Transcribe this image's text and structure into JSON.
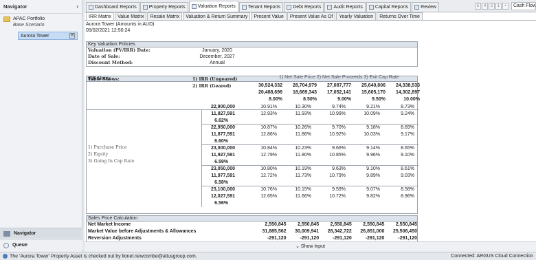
{
  "navigator": {
    "title": "Navigator",
    "collapse_glyph": "‹",
    "portfolio": "APAC Portfolio",
    "scenario": "Base Scenario",
    "property": "Aurora Tower",
    "close_glyph": "✕",
    "tab_navigator": "Navigator",
    "tab_queue": "Queue"
  },
  "tabs": [
    {
      "label": "Dashboard Reports"
    },
    {
      "label": "Property Reports"
    },
    {
      "label": "Valuation Reports"
    },
    {
      "label": "Tenant Reports"
    },
    {
      "label": "Debt Reports"
    },
    {
      "label": "Audit Reports"
    },
    {
      "label": "Capital Reports"
    },
    {
      "label": "Review"
    }
  ],
  "pager": [
    "5",
    "4",
    "2",
    "1",
    "•"
  ],
  "cashflow_select": "Cash Flow",
  "subtabs": [
    {
      "label": "IRR Matrix"
    },
    {
      "label": "Value Matrix"
    },
    {
      "label": "Resale Matrix"
    },
    {
      "label": "Valuation & Return Summary"
    },
    {
      "label": "Present Value"
    },
    {
      "label": "Present Value As Of"
    },
    {
      "label": "Yearly Valuation"
    },
    {
      "label": "Returns Over Time"
    }
  ],
  "report": {
    "title": "Aurora Tower (Amounts in AUD)",
    "datetime": "05/02/2021 12:50:24",
    "policies_title": "Key Valuation Policies",
    "policies": [
      {
        "k": "Valuation (PV/IRR) Date:",
        "v": "January, 2020"
      },
      {
        "k": "Date of Sale:",
        "v": "December, 2027"
      },
      {
        "k": "Discount Method:",
        "v": "Annual"
      }
    ],
    "irr_title": "IRR Matrix",
    "table_shows": "Table Shows:",
    "irr_options": [
      "1) IRR (Ungeared)",
      "2) IRR (Geared)"
    ],
    "col_heading": "1)  Net Sale Price 2)  Net Sale Proceeds 3)  Exit Cap Rate",
    "cols": [
      {
        "a": "30,524,332",
        "b": "20,488,696",
        "c": "8.00%"
      },
      {
        "a": "28,704,979",
        "b": "18,669,343",
        "c": "8.50%"
      },
      {
        "a": "27,087,777",
        "b": "17,052,141",
        "c": "9.00%"
      },
      {
        "a": "25,640,806",
        "b": "15,605,170",
        "c": "9.50%"
      },
      {
        "a": "24,338,533",
        "b": "14,302,897",
        "c": "10.00%"
      }
    ],
    "row_labels": [
      "1) Purchase Price",
      "2) Equity",
      "3) Going In Cap Rate"
    ],
    "rows": [
      {
        "p": "22,900,000",
        "e": "11,827,591",
        "g": "6.62%",
        "u": [
          "10.91%",
          "10.30%",
          "9.74%",
          "9.21%",
          "8.73%"
        ],
        "gr": [
          "12.93%",
          "11.93%",
          "10.99%",
          "10.09%",
          "9.24%"
        ]
      },
      {
        "p": "22,950,000",
        "e": "11,877,591",
        "g": "6.60%",
        "u": [
          "10.87%",
          "10.26%",
          "9.70%",
          "9.18%",
          "8.69%"
        ],
        "gr": [
          "12.86%",
          "11.86%",
          "10.92%",
          "10.03%",
          "9.17%"
        ]
      },
      {
        "p": "23,000,000",
        "e": "11,927,591",
        "g": "6.59%",
        "u": [
          "10.84%",
          "10.23%",
          "9.66%",
          "9.14%",
          "8.65%"
        ],
        "gr": [
          "12.79%",
          "11.80%",
          "10.85%",
          "9.96%",
          "9.10%"
        ]
      },
      {
        "p": "23,050,000",
        "e": "11,977,591",
        "g": "6.58%",
        "u": [
          "10.80%",
          "10.19%",
          "9.63%",
          "9.10%",
          "8.61%"
        ],
        "gr": [
          "12.72%",
          "11.73%",
          "10.79%",
          "9.89%",
          "9.03%"
        ]
      },
      {
        "p": "23,100,000",
        "e": "12,027,591",
        "g": "6.56%",
        "u": [
          "10.76%",
          "10.15%",
          "9.59%",
          "9.07%",
          "8.58%"
        ],
        "gr": [
          "12.65%",
          "11.66%",
          "10.72%",
          "9.82%",
          "8.96%"
        ]
      }
    ],
    "sales_title": "Sales Price Calculation",
    "sales_rows": [
      {
        "label": "Net Market Income",
        "v": [
          "2,550,845",
          "2,550,845",
          "2,550,845",
          "2,550,845",
          "2,550,845"
        ]
      },
      {
        "label": "Market Value before Adjustments & Allowances",
        "v": [
          "31,885,562",
          "30,009,941",
          "28,342,722",
          "26,851,000",
          "25,508,450"
        ]
      },
      {
        "label": "Reversion Adjustments",
        "v": [
          "-291,120",
          "-291,120",
          "-291,120",
          "-291,120",
          "-291,120"
        ]
      }
    ]
  },
  "show_input": "⌄ Show Input",
  "status": {
    "message": "The 'Aurora Tower' Property Asset is checked out by lionel.newcombe@altusgroup.com.",
    "connection": "Connected: ARGUS Cloud Connection"
  },
  "colors": {
    "selected": "#c6dcf4",
    "header": "#dce3ea",
    "border": "#9aa3ad"
  }
}
